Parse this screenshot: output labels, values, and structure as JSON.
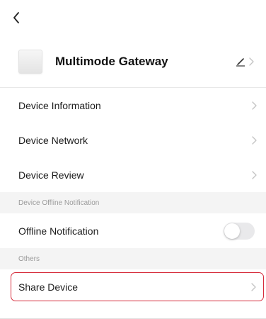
{
  "device": {
    "name": "Multimode Gateway"
  },
  "menu": {
    "device_information": "Device Information",
    "device_network": "Device Network",
    "device_review": "Device Review"
  },
  "sections": {
    "offline_header": "Device Offline Notification",
    "others_header": "Others"
  },
  "offline": {
    "label": "Offline Notification",
    "enabled": false
  },
  "share": {
    "label": "Share Device"
  },
  "icons": {
    "back": "chevron-left-icon",
    "edit": "pencil-icon",
    "chevron": "chevron-right-icon"
  },
  "colors": {
    "highlight_border": "#d62c3c",
    "section_bg": "#f4f4f4",
    "toggle_off": "#e9e9eb"
  }
}
